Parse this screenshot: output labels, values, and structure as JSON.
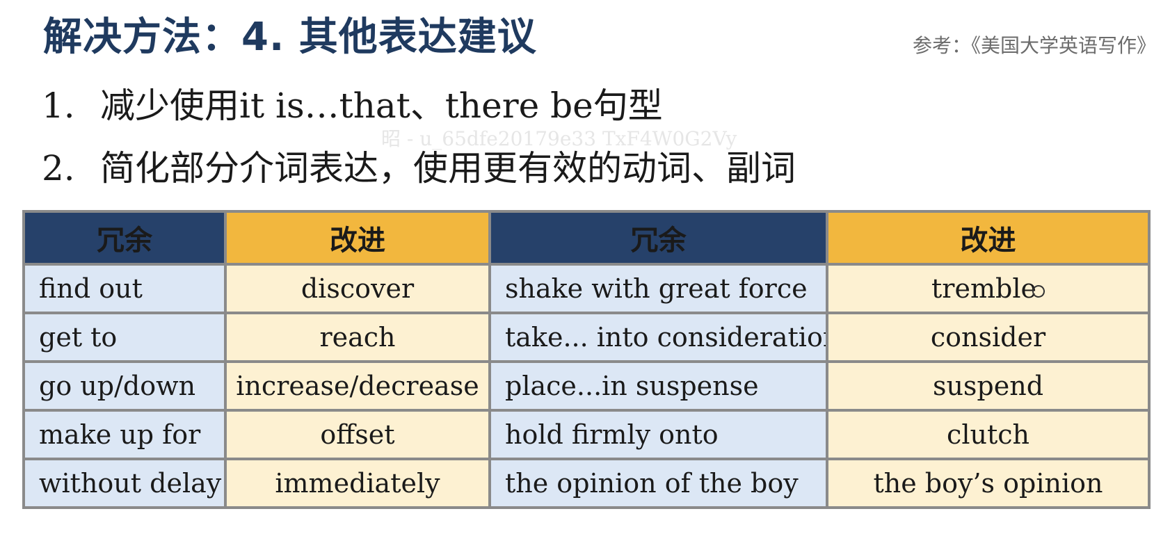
{
  "slide": {
    "title": "解决方法：4. 其他表达建议",
    "reference": "参考：《美国大学英语写作》",
    "watermark_logo": "",
    "watermark_id": "昭 - u_65dfe20179e33 TxF4W0G2Vy"
  },
  "points": [
    {
      "num": "1.",
      "text": "减少使用it is…that、there be句型"
    },
    {
      "num": "2.",
      "text": "简化部分介词表达，使用更有效的动词、副词"
    }
  ],
  "table": {
    "headers": [
      "冗余",
      "改进",
      "冗余",
      "改进"
    ],
    "rows": [
      [
        "find out",
        "discover",
        "shake with great force",
        "tremble"
      ],
      [
        "get to",
        "reach",
        "take... into consideration",
        "consider"
      ],
      [
        "go up/down",
        "increase/decrease",
        "place...in suspense",
        "suspend"
      ],
      [
        "make up for",
        "offset",
        "hold firmly onto",
        "clutch"
      ],
      [
        "without delay",
        "immediately",
        "the opinion of the boy",
        "the boy’s opinion"
      ]
    ]
  },
  "colors": {
    "title": "#1f3a5f",
    "header_redundant": "#26416a",
    "header_improved": "#f2b73e",
    "cell_redundant": "#dce7f5",
    "cell_improved": "#fdf1d2"
  },
  "icons": {
    "cursor": "pencil-cursor-icon"
  }
}
